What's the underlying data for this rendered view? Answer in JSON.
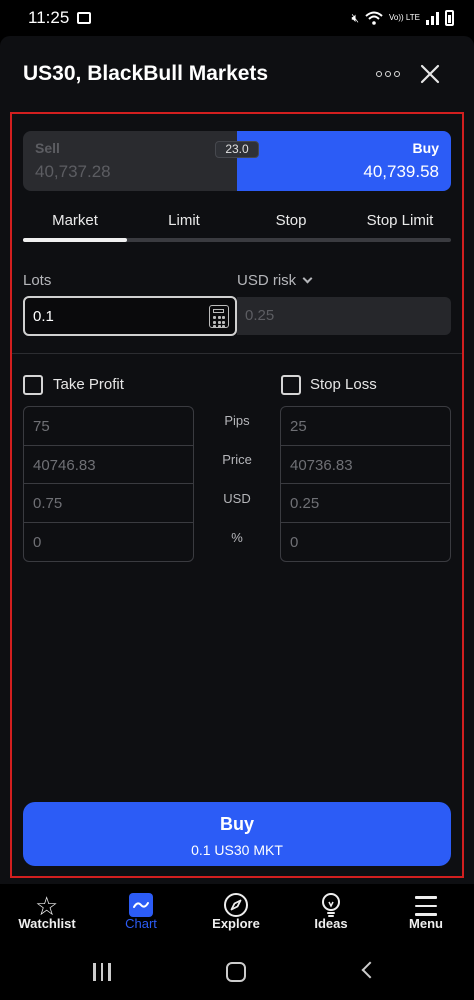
{
  "status_bar": {
    "time": "11:25",
    "lte_label": "Vo)) LTE"
  },
  "header": {
    "title": "US30, BlackBull Markets"
  },
  "quote": {
    "sell_label": "Sell",
    "sell_price": "40,737.28",
    "buy_label": "Buy",
    "buy_price": "40,739.58",
    "spread": "23.0"
  },
  "order_tabs": {
    "items": [
      "Market",
      "Limit",
      "Stop",
      "Stop Limit"
    ],
    "selected": "Market"
  },
  "size": {
    "lots_label": "Lots",
    "lots_value": "0.1",
    "risk_label": "USD risk",
    "risk_value": "0.25"
  },
  "take_profit": {
    "label": "Take Profit",
    "checked": false,
    "pips": "75",
    "price": "40746.83",
    "usd": "0.75",
    "percent": "0"
  },
  "stop_loss": {
    "label": "Stop Loss",
    "checked": false,
    "pips": "25",
    "price": "40736.83",
    "usd": "0.25",
    "percent": "0"
  },
  "field_labels": {
    "pips": "Pips",
    "price": "Price",
    "usd": "USD",
    "percent": "%"
  },
  "action": {
    "title": "Buy",
    "subtitle": "0.1 US30 MKT"
  },
  "bottom_nav": {
    "items": [
      {
        "label": "Watchlist",
        "icon": "star-icon"
      },
      {
        "label": "Chart",
        "icon": "chart-icon",
        "active": true
      },
      {
        "label": "Explore",
        "icon": "compass-icon"
      },
      {
        "label": "Ideas",
        "icon": "lightbulb-icon"
      },
      {
        "label": "Menu",
        "icon": "menu-icon"
      }
    ]
  },
  "colors": {
    "accent": "#2c5cf6",
    "highlight_border": "#d21f1f",
    "background": "#0e0f12"
  }
}
